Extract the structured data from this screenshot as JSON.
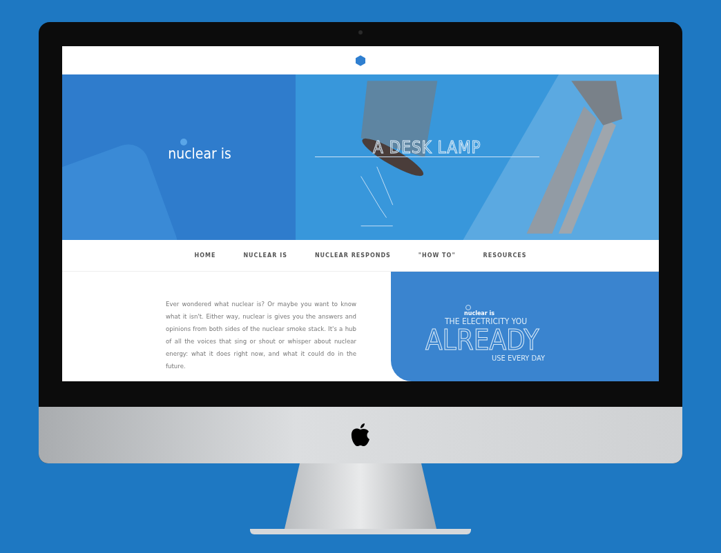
{
  "hero": {
    "brand": "nuclear is",
    "caption": "A DESK LAMP"
  },
  "nav": [
    {
      "label": "HOME"
    },
    {
      "label": "NUCLEAR IS"
    },
    {
      "label": "NUCLEAR RESPONDS"
    },
    {
      "label": "\"HOW TO\""
    },
    {
      "label": "RESOURCES"
    }
  ],
  "intro": "Ever wondered what nuclear is? Or maybe you want to know what it isn't. Either way, nuclear is gives you the answers and opinions from both sides of the nuclear smoke stack. It's a hub of all the voices that sing or shout or whisper about nuclear energy: what it does right now, and what it could do in the future.",
  "promo": {
    "brand": "nuclear is",
    "line_1": "THE ELECTRICITY YOU",
    "headline": "ALREADY",
    "line_2": "USE EVERY DAY"
  }
}
